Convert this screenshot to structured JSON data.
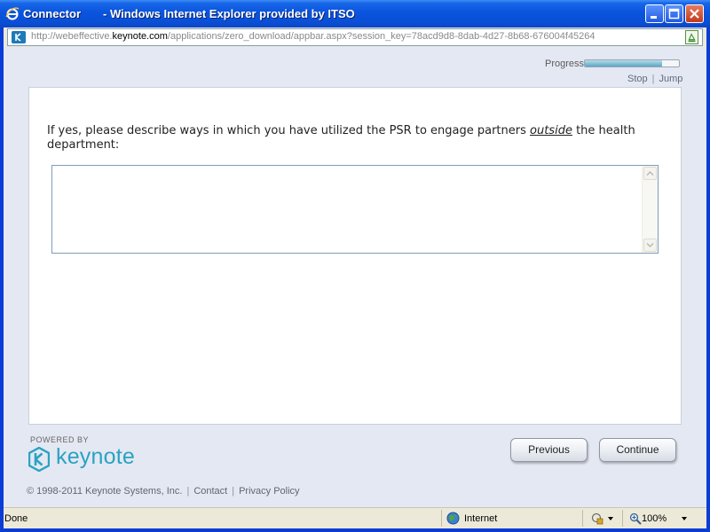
{
  "window": {
    "app_title": "Connector",
    "title_suffix": "- Windows Internet Explorer provided by ITSO"
  },
  "address": {
    "prefix": "http://webeffective.",
    "host": "keynote.com",
    "path": "/applications/zero_download/appbar.aspx?session_key=78acd9d8-8dab-4d27-8b68-676004f45264"
  },
  "progress": {
    "label": "Progress",
    "fraction": 0.82,
    "stop_label": "Stop",
    "jump_label": "Jump",
    "separator": "|"
  },
  "question": {
    "before": "If yes, please describe ways in which you have utilized the PSR to engage partners ",
    "emphasis": "outside",
    "after": " the health department:"
  },
  "answer": {
    "value": ""
  },
  "branding": {
    "powered_by": "POWERED BY",
    "wordmark": "keynote",
    "accent_color": "#2aa2c4"
  },
  "buttons": {
    "previous": "Previous",
    "continue": "Continue"
  },
  "footer": {
    "copyright": "© 1998-2011 Keynote Systems, Inc.",
    "contact": "Contact",
    "privacy": "Privacy Policy",
    "separator": "|"
  },
  "status": {
    "text": "Done",
    "zone": "Internet",
    "zoom": "100%"
  },
  "icons": [
    "ie-logo-icon",
    "minimize-icon",
    "maximize-icon",
    "close-icon",
    "keynote-page-icon",
    "compatibility-icon",
    "scroll-up-icon",
    "scroll-down-icon",
    "keynote-logo-icon",
    "globe-icon",
    "protected-mode-icon",
    "zoom-icon"
  ]
}
